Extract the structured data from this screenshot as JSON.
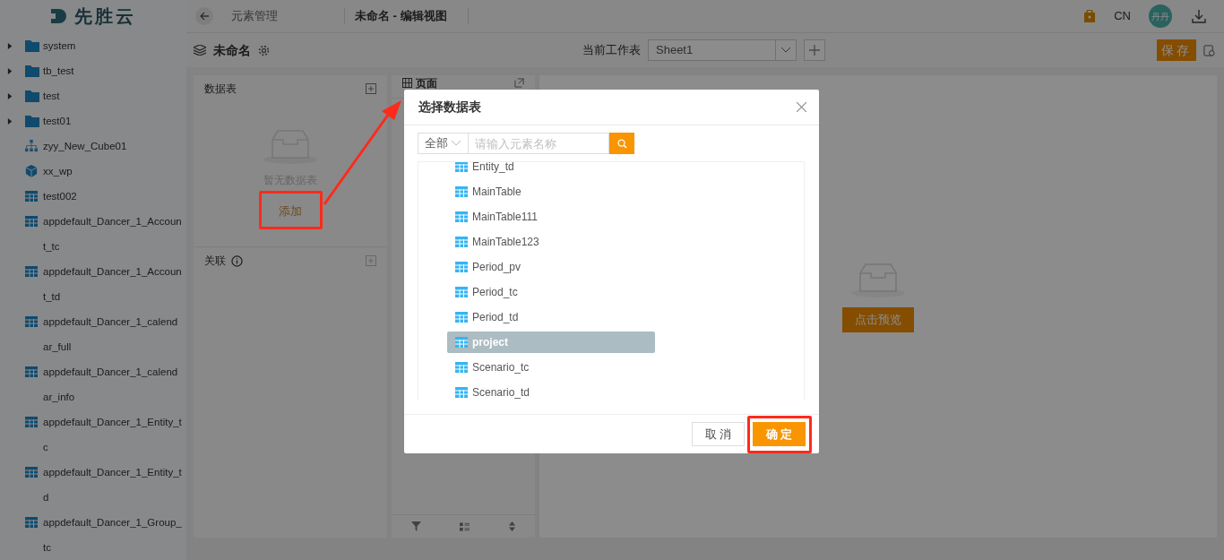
{
  "logo": {
    "text": "先胜云"
  },
  "sidebar": {
    "items": [
      {
        "kind": "folder",
        "label": "system",
        "expanded": false
      },
      {
        "kind": "folder",
        "label": "tb_test",
        "expanded": false
      },
      {
        "kind": "folder",
        "label": "test",
        "expanded": false
      },
      {
        "kind": "folder",
        "label": "test01",
        "expanded": false
      },
      {
        "kind": "model",
        "label": "zyy_New_Cube01"
      },
      {
        "kind": "cube",
        "label": "xx_wp"
      },
      {
        "kind": "table",
        "label": "test002"
      },
      {
        "kind": "table",
        "label": "appdefault_Dancer_1_Account_tc"
      },
      {
        "kind": "table",
        "label": "appdefault_Dancer_1_Account_td"
      },
      {
        "kind": "table",
        "label": "appdefault_Dancer_1_calendar_full"
      },
      {
        "kind": "table",
        "label": "appdefault_Dancer_1_calendar_info"
      },
      {
        "kind": "table",
        "label": "appdefault_Dancer_1_Entity_tc"
      },
      {
        "kind": "table",
        "label": "appdefault_Dancer_1_Entity_td"
      },
      {
        "kind": "table",
        "label": "appdefault_Dancer_1_Group_tc"
      }
    ]
  },
  "header": {
    "breadcrumb": "元素管理",
    "title": "未命名 - 编辑视图",
    "language": "CN",
    "avatar": "丹丹"
  },
  "toolbar": {
    "view_name": "未命名",
    "sheet_label": "当前工作表",
    "sheet": "Sheet1",
    "save": "保存"
  },
  "tables_panel": {
    "title": "数据表",
    "empty_text": "暂无数据表",
    "add": "添加",
    "add_highlighted": true
  },
  "relations_panel": {
    "title": "关联"
  },
  "page_panel": {
    "title": "页面"
  },
  "canvas": {
    "preview": "点击预览"
  },
  "callout_arrow": true,
  "dialog": {
    "title": "选择数据表",
    "filter": "全部",
    "search_placeholder": "请输入元素名称",
    "items": [
      {
        "name": "Entity_td",
        "selected": false
      },
      {
        "name": "MainTable",
        "selected": false
      },
      {
        "name": "MainTable111",
        "selected": false
      },
      {
        "name": "MainTable123",
        "selected": false
      },
      {
        "name": "Period_pv",
        "selected": false
      },
      {
        "name": "Period_tc",
        "selected": false
      },
      {
        "name": "Period_td",
        "selected": false
      },
      {
        "name": "project",
        "selected": true
      },
      {
        "name": "Scenario_tc",
        "selected": false
      },
      {
        "name": "Scenario_td",
        "selected": false
      }
    ],
    "cancel": "取 消",
    "ok": "确 定",
    "ok_highlighted": true
  }
}
